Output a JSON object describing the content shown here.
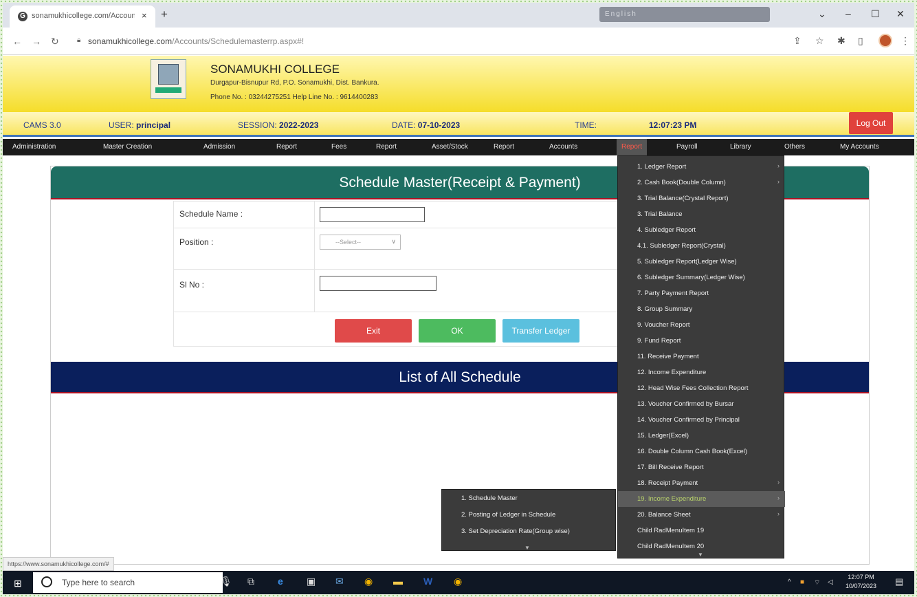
{
  "browser": {
    "tab_title": "sonamukhicollege.com/Accoun",
    "tab_close": "×",
    "new_tab": "+",
    "url_host": "sonamukhicollege.com",
    "url_path": "/Accounts/Schedulemasterrp.aspx#!",
    "system_strip": "English",
    "status_url": "https://www.sonamukhicollege.com/#"
  },
  "header": {
    "college_name": "SONAMUKHI COLLEGE",
    "address": "Durgapur-Bisnupur Rd, P.O. Sonamukhi, Dist. Bankura.",
    "phone": "Phone No. : 03244275251  Help Line No. : 9614400283"
  },
  "infobar": {
    "app": "CAMS 3.0",
    "user_label": "USER: ",
    "user_value": "principal",
    "session_label": "SESSION: ",
    "session_value": "2022-2023",
    "date_label": "DATE: ",
    "date_value": "07-10-2023",
    "time_label": "TIME:",
    "time_value": "12:07:23 PM",
    "logout": "Log Out"
  },
  "menu": [
    "Administration",
    "Master Creation",
    "Admission",
    "Report",
    "Fees",
    "Report",
    "Asset/Stock",
    "Report",
    "Accounts",
    "Report",
    "Payroll",
    "Library",
    "Others",
    "My Accounts"
  ],
  "form": {
    "title": "Schedule Master(Receipt & Payment)",
    "schedule_name_label": "Schedule Name :",
    "schedule_name_value": "",
    "position_label": "Position :",
    "position_value": "--Select--",
    "sl_no_label": "Sl No :",
    "sl_no_value": "",
    "exit_label": "Exit",
    "ok_label": "OK",
    "transfer_label": "Transfer Ledger",
    "list_title": "List of All Schedule"
  },
  "report_menu": [
    "1. Ledger Report",
    "2. Cash Book(Double Column)",
    "3. Trial Balance(Crystal Report)",
    "3. Trial Balance",
    "4. Subledger Report",
    "4.1. Subledger Report(Crystal)",
    "5. Subledger Report(Ledger Wise)",
    "6. Subledger Summary(Ledger Wise)",
    "7. Party Payment Report",
    "8. Group Summary",
    "9. Voucher Report",
    "9. Fund Report",
    "11. Receive Payment",
    "12. Income Expenditure",
    "12. Head Wise Fees Collection Report",
    "13. Voucher Confirmed by Bursar",
    "14. Voucher Confirmed by Principal",
    "15. Ledger(Excel)",
    "16. Double Column Cash Book(Excel)",
    "17. Bill Receive Report",
    "18. Receipt Payment",
    "19. Income Expenditure",
    "20. Balance Sheet",
    "Child RadMenuItem 19",
    "Child RadMenuItem 20"
  ],
  "sub_menu": [
    "1. Schedule Master",
    "2. Posting of Ledger in Schedule",
    "3. Set Depreciation Rate(Group wise)"
  ],
  "taskbar": {
    "search_placeholder": "Type here to search",
    "time": "12:07 PM",
    "date": "10/07/2023"
  },
  "colors": {
    "form_header": "#1e6e62",
    "list_header": "#0a1f5c",
    "exit": "#e04a4a",
    "ok": "#4dbb5f",
    "transfer": "#5bc0de",
    "menu_highlight": "#b9d36b"
  }
}
